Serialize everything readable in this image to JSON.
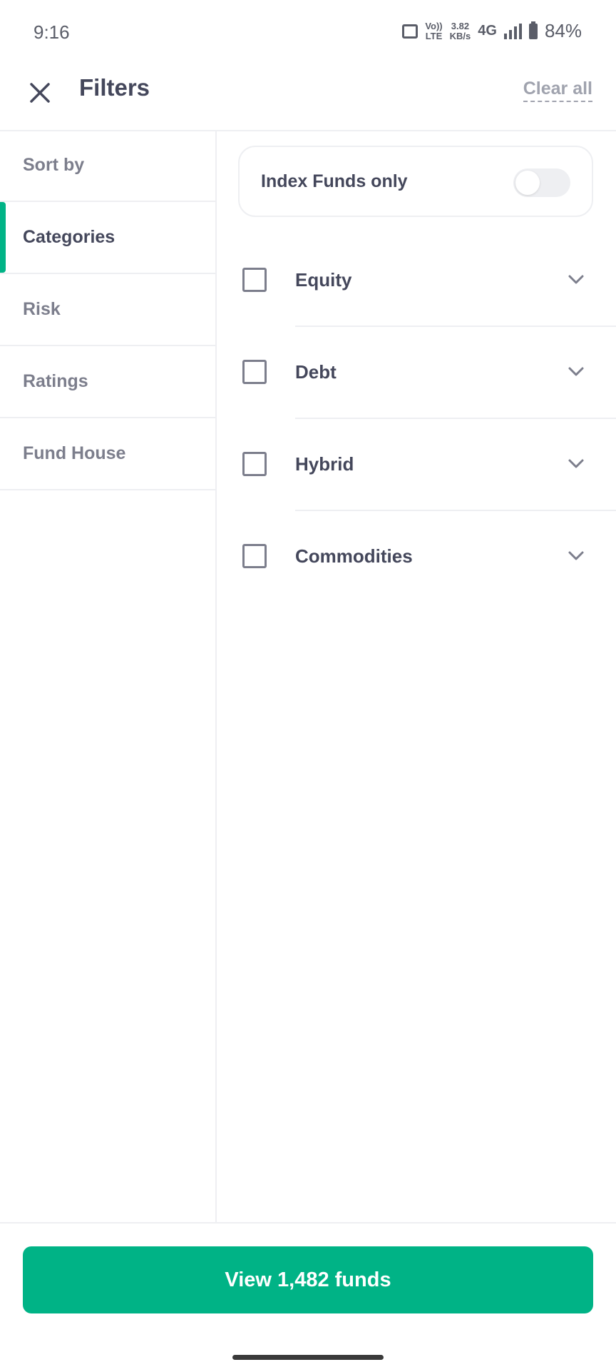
{
  "status_bar": {
    "time": "9:16",
    "volte_top": "Vo))",
    "volte_bottom": "LTE",
    "speed_value": "3.82",
    "speed_unit": "KB/s",
    "network": "4G",
    "battery": "84%"
  },
  "header": {
    "title": "Filters",
    "clear_all": "Clear all"
  },
  "sidebar": {
    "items": [
      {
        "label": "Sort by"
      },
      {
        "label": "Categories",
        "active": true
      },
      {
        "label": "Risk"
      },
      {
        "label": "Ratings"
      },
      {
        "label": "Fund House"
      }
    ]
  },
  "content": {
    "index_funds_label": "Index Funds only",
    "index_funds_enabled": false,
    "categories": [
      {
        "label": "Equity",
        "checked": false
      },
      {
        "label": "Debt",
        "checked": false
      },
      {
        "label": "Hybrid",
        "checked": false
      },
      {
        "label": "Commodities",
        "checked": false
      }
    ]
  },
  "footer": {
    "cta_label": "View 1,482 funds"
  },
  "colors": {
    "accent": "#00b386",
    "text": "#44475b",
    "muted": "#7c7e8c",
    "divider": "#eeeff2"
  }
}
